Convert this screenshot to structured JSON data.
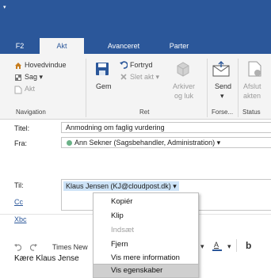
{
  "quick_access": {
    "glyph": "▾"
  },
  "tabs": [
    {
      "label": "F2",
      "active": false
    },
    {
      "label": "Akt",
      "active": true
    },
    {
      "label": "Avanceret",
      "active": false
    },
    {
      "label": "Parter",
      "active": false
    }
  ],
  "ribbon": {
    "navigation": {
      "items": [
        "Hovedvindue",
        "Sag",
        "Akt"
      ],
      "sag_arrow": "▾",
      "label": "Navigation"
    },
    "ret": {
      "gem": "Gem",
      "fortryd": "Fortryd",
      "slet_akt": "Slet akt",
      "slet_arrow": "▾",
      "arkiver_line1": "Arkiver",
      "arkiver_line2": "og luk",
      "label": "Ret"
    },
    "forse": {
      "send_line1": "Send",
      "send_arrow": "▾",
      "label": "Forse..."
    },
    "status": {
      "afslut_line1": "Afslut",
      "afslut_line2": "akten",
      "label": "Status"
    }
  },
  "fields": {
    "titel": {
      "label": "Titel:",
      "value": "Anmodning om faglig vurdering"
    },
    "fra": {
      "label": "Fra:",
      "value": "Ann Sekner (Sagsbehandler, Administration)",
      "arrow": "▾",
      "status_color": "#6ab187"
    },
    "til": {
      "label": "Til:",
      "value": "Klaus Jensen (KJ@cloudpost.dk)",
      "arrow": "▾"
    },
    "cc": {
      "label": "Cc"
    },
    "bcc": {
      "label": "Xbc"
    }
  },
  "context_menu": {
    "items": [
      {
        "label": "Kopiér",
        "disabled": false,
        "highlighted": false
      },
      {
        "label": "Klip",
        "disabled": false,
        "highlighted": false
      },
      {
        "label": "Indsæt",
        "disabled": true,
        "highlighted": false
      },
      {
        "label": "Fjern",
        "disabled": false,
        "highlighted": false
      },
      {
        "label": "Vis mere information",
        "disabled": false,
        "highlighted": false
      },
      {
        "label": "Vis egenskaber",
        "disabled": false,
        "highlighted": true
      }
    ]
  },
  "toolbar": {
    "font_name": "Times New",
    "bold": "b",
    "dropdown_arrow": "▾",
    "highlight_letter": "A"
  },
  "body": {
    "greeting": "Kære Klaus Jense"
  }
}
